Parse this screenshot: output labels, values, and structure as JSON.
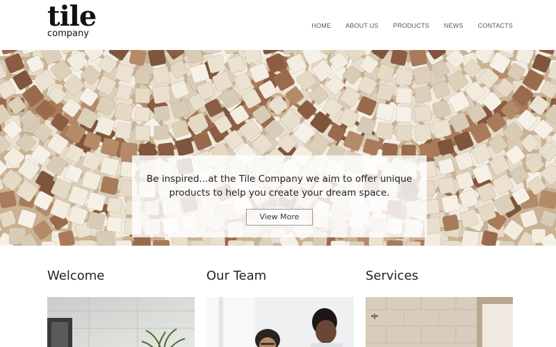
{
  "logo": {
    "main": "tile",
    "sub": "company"
  },
  "nav": {
    "items": [
      {
        "label": "HOME"
      },
      {
        "label": "ABOUT US"
      },
      {
        "label": "PRODUCTS"
      },
      {
        "label": "NEWS"
      },
      {
        "label": "CONTACTS"
      }
    ]
  },
  "hero": {
    "text_line1": "Be inspired...at the Tile Company we aim to offer unique",
    "text_line2": "products to help you create your dream space.",
    "button_label": "View More"
  },
  "sections": [
    {
      "title": "Welcome"
    },
    {
      "title": "Our Team"
    },
    {
      "title": "Services"
    }
  ],
  "colors": {
    "grout": "#cbb292",
    "tile_light": "#efe6d8",
    "tile_dark": "#9a6a4c"
  }
}
